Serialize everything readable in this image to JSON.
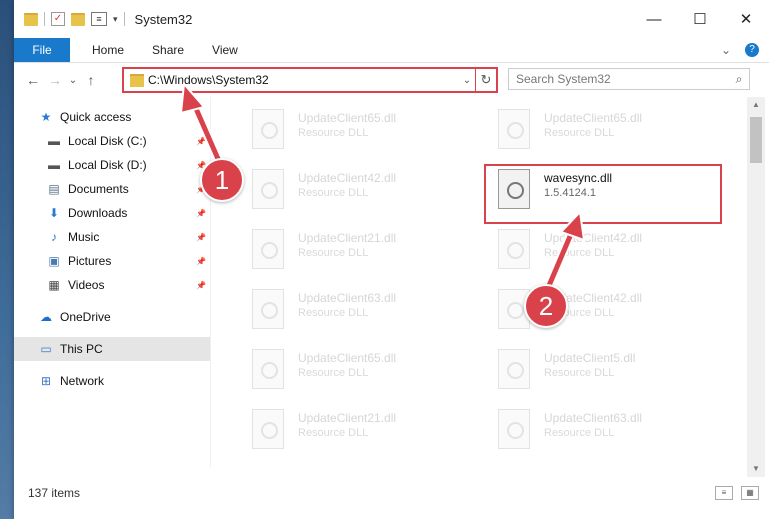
{
  "window": {
    "title": "System32",
    "controls": {
      "minimize": "—",
      "maximize": "☐",
      "close": "✕"
    }
  },
  "quick_access_toolbar": {
    "icons": [
      "folder-icon",
      "properties-check-icon",
      "new-folder-icon",
      "properties-icon",
      "customize-arrow-icon"
    ]
  },
  "ribbon": {
    "file": "File",
    "tabs": [
      "Home",
      "Share",
      "View"
    ],
    "expand": "⌄",
    "help": "?"
  },
  "nav": {
    "back": "←",
    "forward": "→",
    "recent": "⌄",
    "up": "↑",
    "address": "C:\\Windows\\System32",
    "search_placeholder": "Search System32"
  },
  "sidebar": {
    "items": [
      {
        "label": "Quick access",
        "icon": "star-icon",
        "glyph": "★",
        "color": "#2b78d0",
        "pinned": false
      },
      {
        "label": "Local Disk (C:)",
        "icon": "drive-icon",
        "glyph": "▬",
        "color": "#555555",
        "pinned": true
      },
      {
        "label": "Local Disk (D:)",
        "icon": "drive-icon",
        "glyph": "▬",
        "color": "#555555",
        "pinned": true
      },
      {
        "label": "Documents",
        "icon": "documents-icon",
        "glyph": "▤",
        "color": "#5a6f8a",
        "pinned": true
      },
      {
        "label": "Downloads",
        "icon": "downloads-icon",
        "glyph": "⬇",
        "color": "#2b78d0",
        "pinned": true
      },
      {
        "label": "Music",
        "icon": "music-icon",
        "glyph": "♪",
        "color": "#2b78d0",
        "pinned": true
      },
      {
        "label": "Pictures",
        "icon": "pictures-icon",
        "glyph": "▣",
        "color": "#4a7bb0",
        "pinned": true
      },
      {
        "label": "Videos",
        "icon": "videos-icon",
        "glyph": "▦",
        "color": "#444444",
        "pinned": true
      },
      {
        "label": "OneDrive",
        "icon": "onedrive-icon",
        "glyph": "☁",
        "color": "#1a6fcf",
        "pinned": false
      },
      {
        "label": "This PC",
        "icon": "this-pc-icon",
        "glyph": "▭",
        "color": "#3a7bc8",
        "pinned": false,
        "selected": true
      },
      {
        "label": "Network",
        "icon": "network-icon",
        "glyph": "⊞",
        "color": "#3a7bc8",
        "pinned": false
      }
    ]
  },
  "files": [
    {
      "name": "UpdateClient65.dll",
      "desc": "Resource DLL"
    },
    {
      "name": "UpdateClient65.dll",
      "desc": "Resource DLL"
    },
    {
      "name": "UpdateClient42.dll",
      "desc": "Resource DLL"
    },
    {
      "name": "wavesync.dll",
      "desc": "1.5.4124.1",
      "highlighted": true
    },
    {
      "name": "UpdateClient21.dll",
      "desc": "Resource DLL"
    },
    {
      "name": "UpdateClient42.dll",
      "desc": "Resource DLL"
    },
    {
      "name": "UpdateClient63.dll",
      "desc": "Resource DLL"
    },
    {
      "name": "UpdateClient42.dll",
      "desc": "Resource DLL"
    },
    {
      "name": "UpdateClient65.dll",
      "desc": "Resource DLL"
    },
    {
      "name": "UpdateClient5.dll",
      "desc": "Resource DLL"
    },
    {
      "name": "UpdateClient21.dll",
      "desc": "Resource DLL"
    },
    {
      "name": "UpdateClient63.dll",
      "desc": "Resource DLL"
    }
  ],
  "status": {
    "item_count": "137 items"
  },
  "annotations": {
    "step1": "1",
    "step2": "2",
    "color": "#d9414b"
  }
}
